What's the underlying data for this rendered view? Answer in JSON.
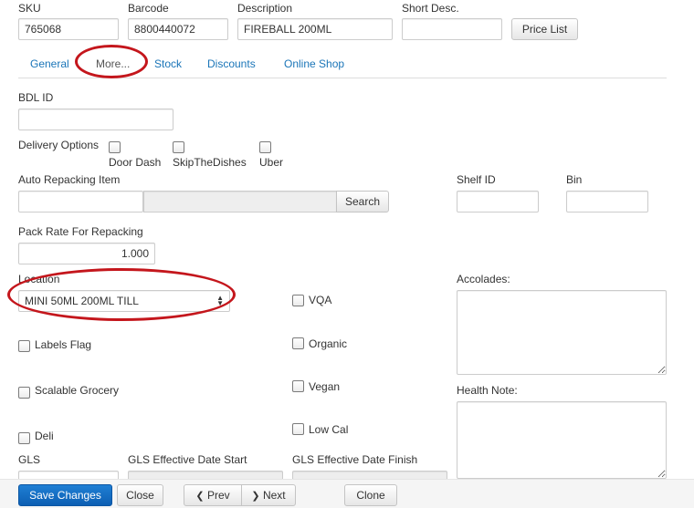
{
  "fields": {
    "sku": {
      "label": "SKU",
      "value": "765068"
    },
    "barcode": {
      "label": "Barcode",
      "value": "8800440072"
    },
    "description": {
      "label": "Description",
      "value": "FIREBALL 200ML"
    },
    "short_desc": {
      "label": "Short Desc.",
      "value": ""
    },
    "price_list_button": "Price List"
  },
  "tabs": [
    {
      "label": "General"
    },
    {
      "label": "More..."
    },
    {
      "label": "Stock"
    },
    {
      "label": "Discounts"
    },
    {
      "label": "Online Shop"
    }
  ],
  "more": {
    "bdl_id": {
      "label": "BDL ID",
      "value": ""
    },
    "delivery_options": {
      "label": "Delivery Options",
      "items": [
        {
          "label": "Door Dash",
          "checked": false
        },
        {
          "label": "SkipTheDishes",
          "checked": false
        },
        {
          "label": "Uber",
          "checked": false
        }
      ]
    },
    "auto_repacking": {
      "label": "Auto Repacking Item",
      "value": "",
      "search_button": "Search"
    },
    "shelf_id": {
      "label": "Shelf ID",
      "value": ""
    },
    "bin": {
      "label": "Bin",
      "value": ""
    },
    "pack_rate": {
      "label": "Pack Rate For Repacking",
      "value": "1.000"
    },
    "location": {
      "label": "Location",
      "value": "MINI 50ML 200ML TILL"
    },
    "flags_left": [
      {
        "label": "Labels Flag",
        "checked": false
      },
      {
        "label": "Scalable Grocery",
        "checked": false
      },
      {
        "label": "Deli",
        "checked": false
      }
    ],
    "flags_middle": [
      {
        "label": "VQA",
        "checked": false
      },
      {
        "label": "Organic",
        "checked": false
      },
      {
        "label": "Vegan",
        "checked": false
      },
      {
        "label": "Low Cal",
        "checked": false
      }
    ],
    "accolades": {
      "label": "Accolades:",
      "value": ""
    },
    "health_note": {
      "label": "Health Note:",
      "value": ""
    },
    "gls": {
      "label": "GLS",
      "value": ""
    },
    "gls_start": {
      "label": "GLS Effective Date Start",
      "value": ""
    },
    "gls_finish": {
      "label": "GLS Effective Date Finish",
      "value": ""
    }
  },
  "footer": {
    "save": "Save Changes",
    "close": "Close",
    "prev": "Prev",
    "next": "Next",
    "clone": "Clone"
  },
  "colors": {
    "accent": "#1a75b8",
    "primary_button": "#0d5fb3",
    "annotation": "#c4161c"
  }
}
